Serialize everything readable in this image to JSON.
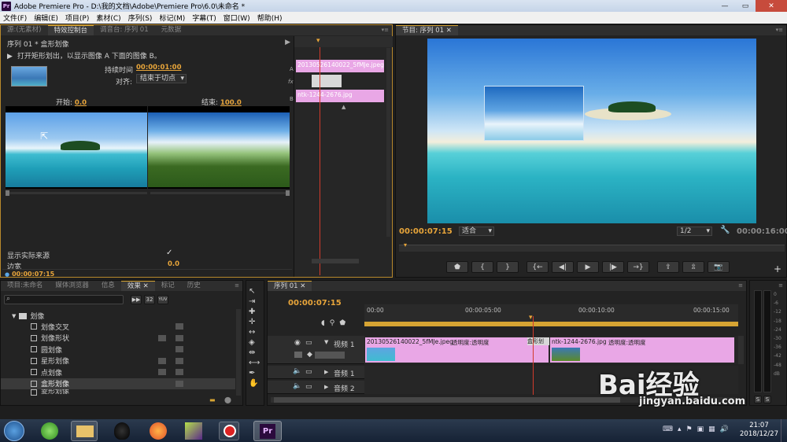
{
  "window": {
    "app_icon": "Pr",
    "title": "Adobe Premiere Pro - D:\\我的文档\\Adobe\\Premiere Pro\\6.0\\未命名 *",
    "min": "—",
    "max": "▭",
    "close": "✕"
  },
  "menu": [
    "文件(F)",
    "编辑(E)",
    "项目(P)",
    "素材(C)",
    "序列(S)",
    "标记(M)",
    "字幕(T)",
    "窗口(W)",
    "帮助(H)"
  ],
  "source_panel": {
    "tabs": [
      "源:(无素材)",
      "特效控制台",
      "调音台: 序列 01",
      "元数据"
    ],
    "sequence_label": "序列 01 * 盒形划像",
    "description": "打开矩形划出，以显示图像 A 下面的图像 B。",
    "duration_label": "持续时间",
    "duration_value": "00:00:01:00",
    "align_label": "对齐:",
    "align_value": "结束于切点",
    "start_label": "开始:",
    "start_value": "0.0",
    "end_label": "结束:",
    "end_value": "100.0",
    "show_actual_source": "显示实际来源",
    "border_label": "边宽",
    "border_value": "0.0",
    "timecode": "00:00:07:15",
    "clip_a": "20130526140022_5fMJe.jpeg",
    "clip_b": "ntk-1244-2676.jpg",
    "track_a": "A",
    "track_b": "B",
    "fx_label": "fx"
  },
  "program_monitor": {
    "tab": "节目: 序列 01",
    "timecode": "00:00:07:15",
    "fit": "适合",
    "resolution": "1/2",
    "duration": "00:00:16:00"
  },
  "project_panel": {
    "tabs": [
      "项目:未命名",
      "媒体浏览器",
      "信息",
      "效果",
      "标记",
      "历史"
    ],
    "badge_32": "32",
    "badge_yuv": "YUV",
    "folder": "划像",
    "items": [
      "划像交叉",
      "划像形状",
      "圆划像",
      "星形划像",
      "点划像",
      "盒形划像",
      "菱形划像"
    ]
  },
  "timeline": {
    "tab": "序列 01",
    "timecode": "00:00:07:15",
    "ruler": [
      "00:00",
      "00:00:05:00",
      "00:00:10:00",
      "00:00:15:00"
    ],
    "video_track": "视频 1",
    "audio_tracks": [
      "音频 1",
      "音频 2"
    ],
    "clip1_label": "20130526140022_5fMJe.jpeg",
    "clip1_fx": "透明度:透明度",
    "transition_label": "盒形划",
    "clip2_label": "ntk-1244-2676.jpg",
    "clip2_fx": "透明度:透明度"
  },
  "meter": {
    "labels": [
      "0",
      "-6",
      "-12",
      "-18",
      "-24",
      "-30",
      "-36",
      "-42",
      "-48",
      "dB"
    ],
    "solo": "S"
  },
  "taskbar": {
    "time": "21:07",
    "date": "2018/12/27"
  },
  "watermark": {
    "brand": "Bai经验",
    "url": "jingyan.baidu.com"
  },
  "colors": {
    "accent_timecode": "#e8a53a",
    "clip_pink": "#e9a7e6",
    "playhead": "#d23b2c"
  }
}
